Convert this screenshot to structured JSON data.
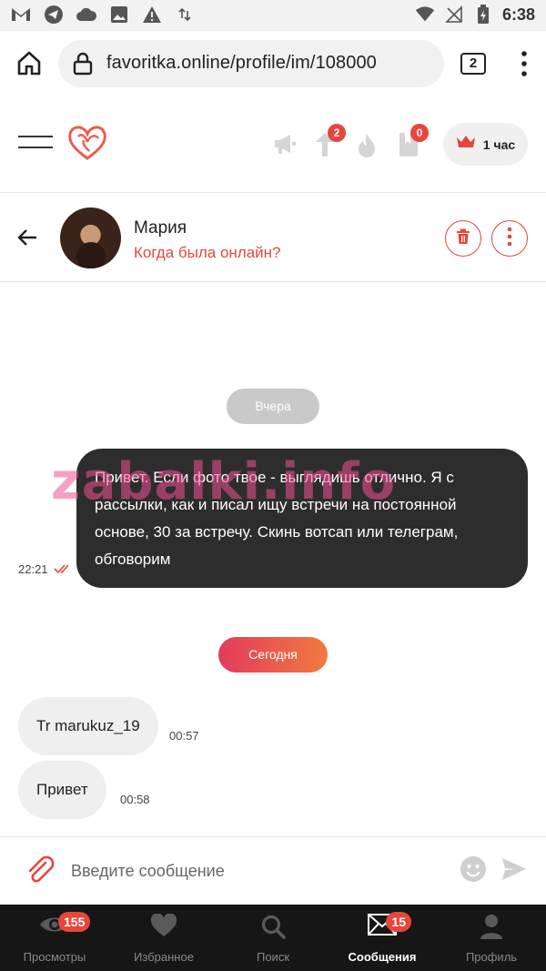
{
  "status_bar": {
    "time": "6:38"
  },
  "browser": {
    "url": "favoritka.online/profile/im/108000",
    "tab_count": "2"
  },
  "header": {
    "boost_badge": "2",
    "bookmarks_badge": "0",
    "premium_label": "1 час",
    "accent_color": "#e8453c"
  },
  "chat": {
    "contact_name": "Мария",
    "contact_status": "Когда была онлайн?",
    "date_yesterday": "Вчера",
    "date_today": "Сегодня",
    "watermark": "zabalki.info",
    "messages": [
      {
        "direction": "out",
        "text": "Привет. Если фото твое - выглядишь отлично. Я с рассылки, как и писал ищу встречи на постоянной основе, 30 за встречу. Скинь вотсап или телеграм, обговорим",
        "time": "22:21"
      },
      {
        "direction": "in",
        "text": "Tr marukuz_19",
        "time": "00:57"
      },
      {
        "direction": "in",
        "text": "Привет",
        "time": "00:58"
      }
    ]
  },
  "input": {
    "placeholder": "Введите сообщение"
  },
  "bottom_nav": {
    "items": [
      {
        "label": "Просмотры",
        "icon": "eye-icon",
        "badge": "155"
      },
      {
        "label": "Избранное",
        "icon": "heart-icon"
      },
      {
        "label": "Поиск",
        "icon": "search-icon"
      },
      {
        "label": "Сообщения",
        "icon": "mail-icon",
        "badge": "15",
        "active": true
      },
      {
        "label": "Профиль",
        "icon": "profile-icon"
      }
    ]
  }
}
